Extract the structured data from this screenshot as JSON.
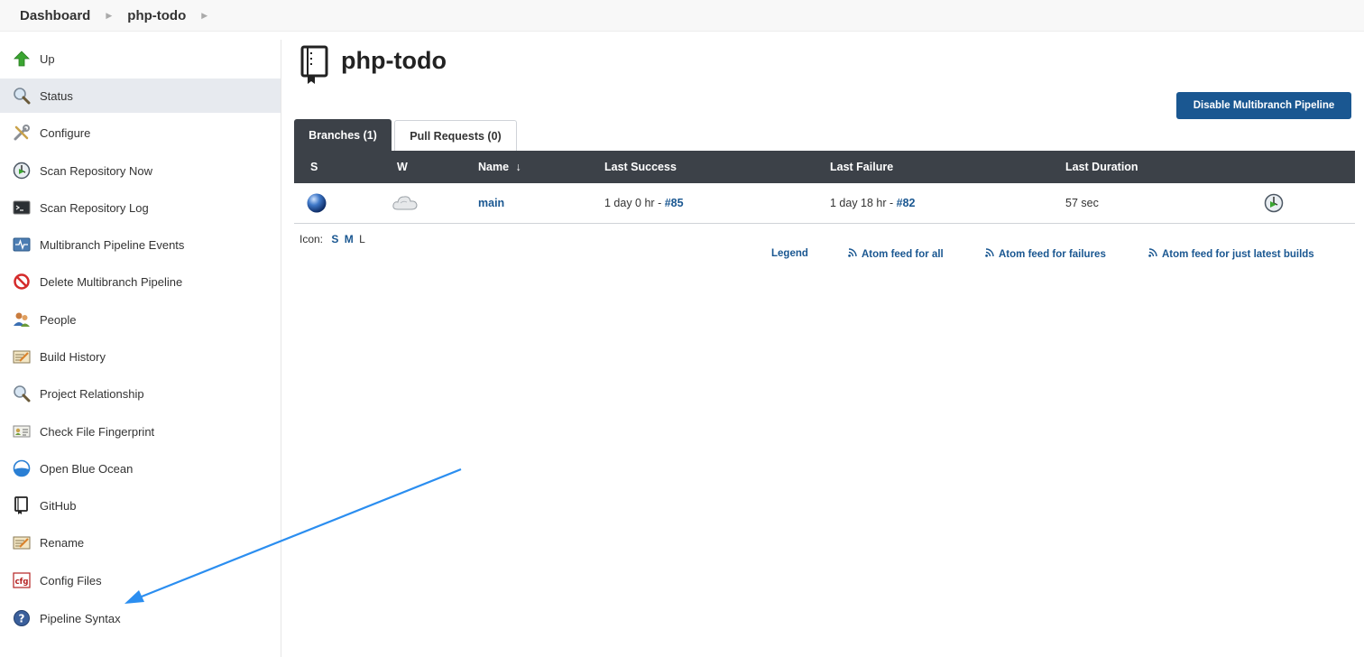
{
  "breadcrumb": {
    "items": [
      "Dashboard",
      "php-todo"
    ]
  },
  "sidebar": {
    "items": [
      {
        "label": "Up",
        "icon": "up-arrow-icon"
      },
      {
        "label": "Status",
        "icon": "magnifier-icon",
        "active": true
      },
      {
        "label": "Configure",
        "icon": "wrench-screwdriver-icon"
      },
      {
        "label": "Scan Repository Now",
        "icon": "scan-clock-icon"
      },
      {
        "label": "Scan Repository Log",
        "icon": "terminal-icon"
      },
      {
        "label": "Multibranch Pipeline Events",
        "icon": "monitor-pulse-icon"
      },
      {
        "label": "Delete Multibranch Pipeline",
        "icon": "no-entry-icon"
      },
      {
        "label": "People",
        "icon": "people-icon"
      },
      {
        "label": "Build History",
        "icon": "notepad-icon"
      },
      {
        "label": "Project Relationship",
        "icon": "magnifier-icon"
      },
      {
        "label": "Check File Fingerprint",
        "icon": "fingerprint-card-icon"
      },
      {
        "label": "Open Blue Ocean",
        "icon": "blue-ocean-icon"
      },
      {
        "label": "GitHub",
        "icon": "repo-book-icon"
      },
      {
        "label": "Rename",
        "icon": "notepad-icon"
      },
      {
        "label": "Config Files",
        "icon": "cfg-file-icon"
      },
      {
        "label": "Pipeline Syntax",
        "icon": "help-circle-icon"
      }
    ]
  },
  "main": {
    "title": "php-todo",
    "title_icon": "repo-book-icon",
    "disable_button": "Disable Multibranch Pipeline",
    "tabs": [
      {
        "label": "Branches (1)",
        "active": true
      },
      {
        "label": "Pull Requests (0)",
        "active": false
      }
    ],
    "table": {
      "headers": {
        "s": "S",
        "w": "W",
        "name": "Name",
        "sort_indicator": "↓",
        "last_success": "Last Success",
        "last_failure": "Last Failure",
        "last_duration": "Last Duration"
      },
      "rows": [
        {
          "status_icon": "blue-ball-icon",
          "weather_icon": "cloud-icon",
          "name": "main",
          "last_success_text": "1 day 0 hr - ",
          "last_success_build": "#85",
          "last_failure_text": "1 day 18 hr - ",
          "last_failure_build": "#82",
          "last_duration": "57 sec",
          "action_icon": "schedule-build-icon"
        }
      ]
    },
    "icon_size": {
      "label": "Icon:",
      "sizes": [
        "S",
        "M",
        "L"
      ],
      "current": "L"
    },
    "footer_links": {
      "legend": "Legend",
      "atom_all": "Atom feed for all",
      "atom_failures": "Atom feed for failures",
      "atom_latest": "Atom feed for just latest builds"
    }
  },
  "colors": {
    "accent": "#1a5791",
    "table_header": "#3c4148",
    "annotation_arrow": "#2b8ef0"
  }
}
